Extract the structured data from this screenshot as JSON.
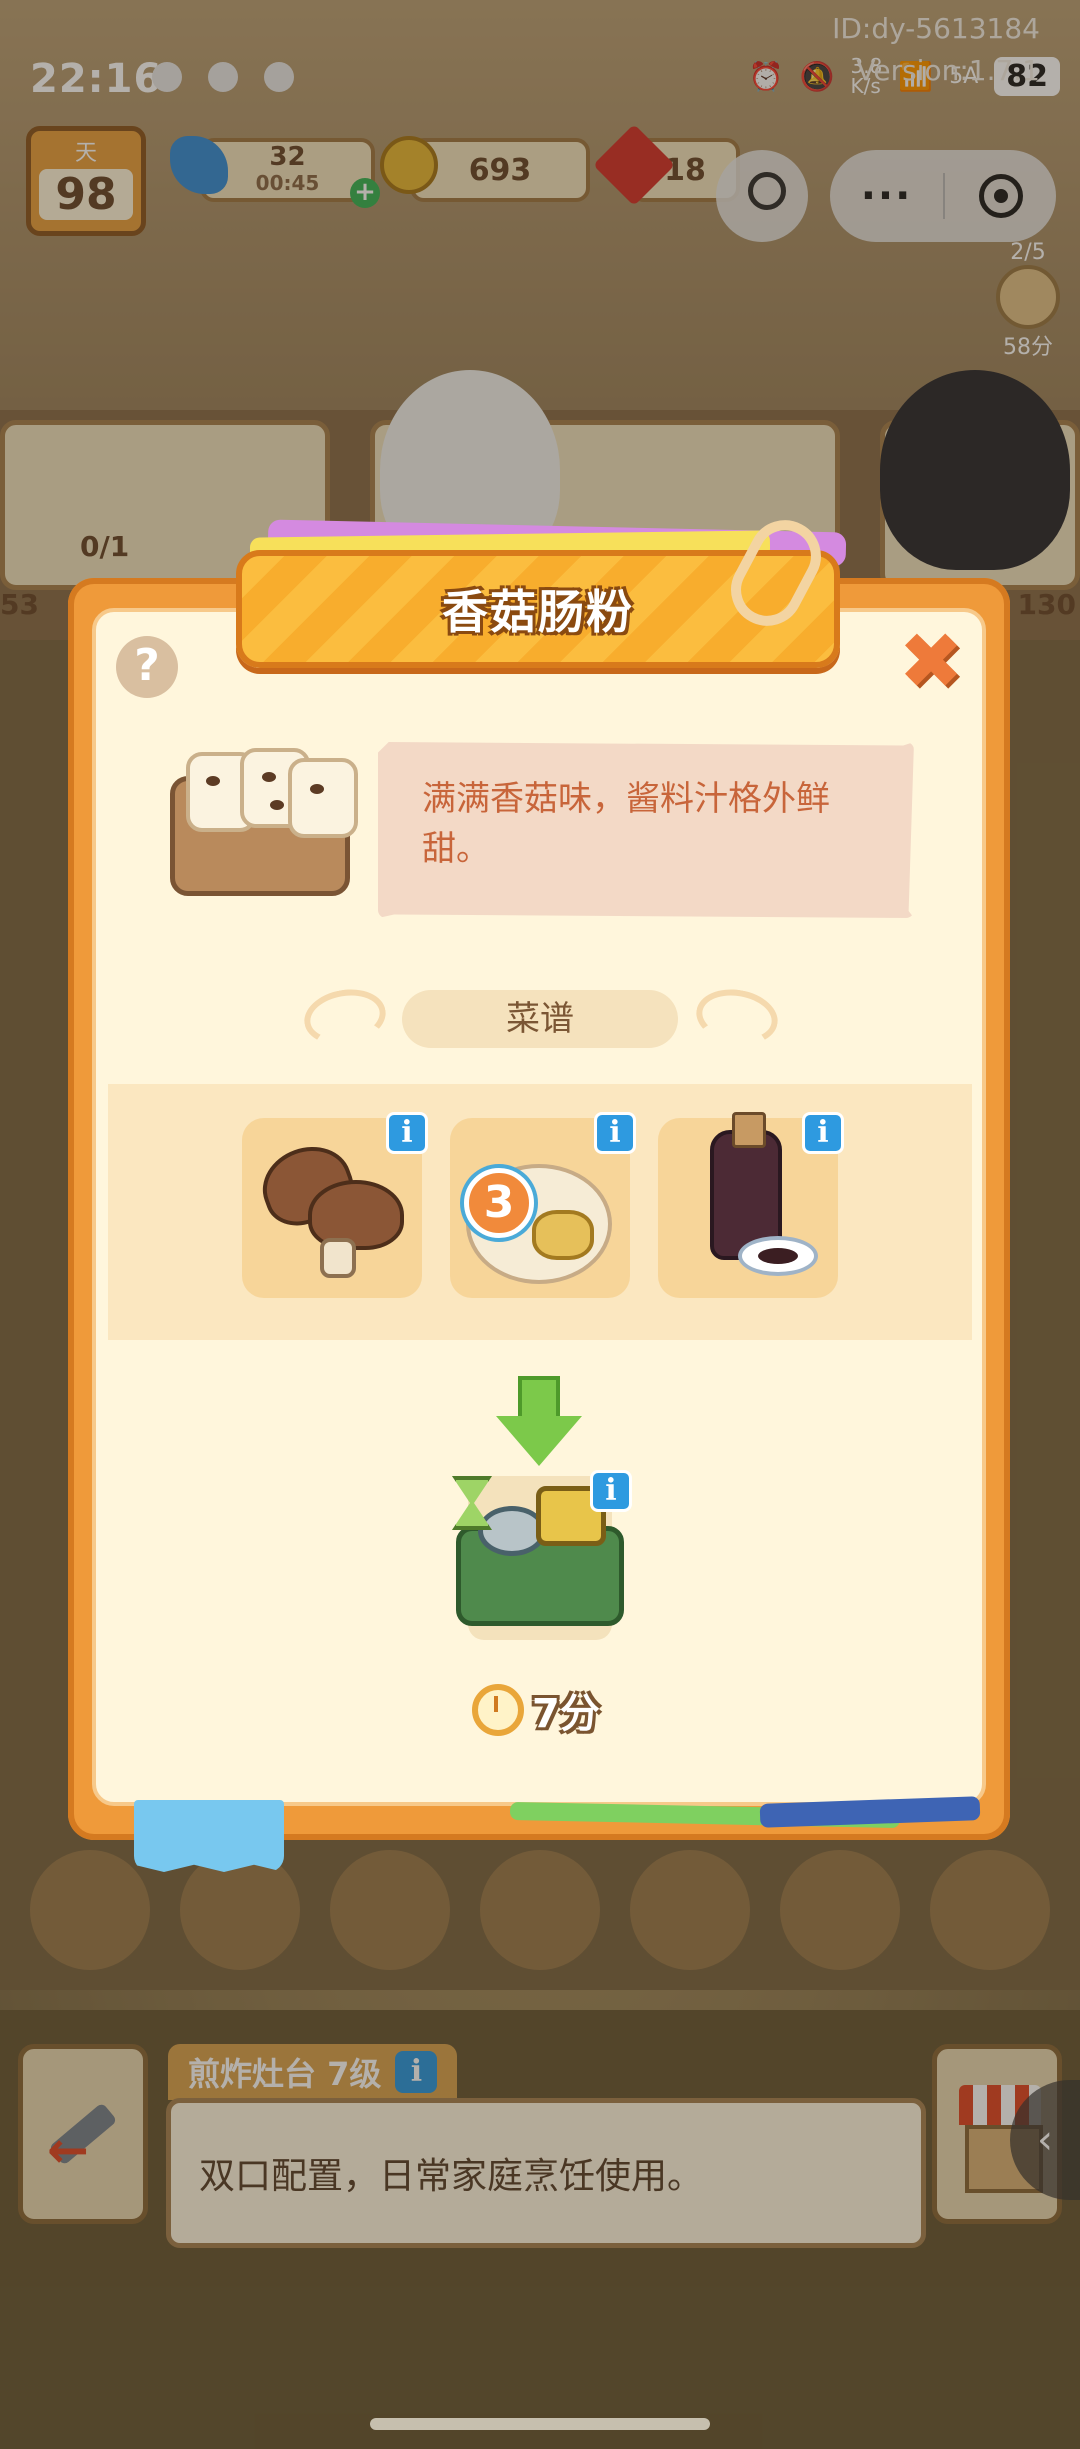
{
  "status_bar": {
    "time": "22:16",
    "network_speed": "3.8\nK/s",
    "network_type": "5A",
    "battery": "82",
    "debug_id": "ID:dy-5613184",
    "version": "Version:1.7.1"
  },
  "resources": {
    "day_label": "天",
    "day_value": "98",
    "energy": "32",
    "energy_timer": "00:45",
    "coins": "693",
    "gems": "18",
    "order_progress": "2/5",
    "order_time": "58分"
  },
  "background": {
    "order_count": "0/1",
    "left_number": "53",
    "right_number": "130"
  },
  "modal": {
    "title": "香菇肠粉",
    "description": "满满香菇味，酱料汁格外鲜甜。",
    "section_label": "菜谱",
    "ingredient_count": "3",
    "info_glyph": "i",
    "cook_time": "7分",
    "close_glyph": "✖",
    "help_glyph": "?"
  },
  "station": {
    "title": "煎炸灶台 7级",
    "description": "双口配置，日常家庭烹饪使用。"
  },
  "icons": {
    "side_arrow": "‹"
  },
  "colors": {
    "modal_frame": "#ef9a3a",
    "modal_body": "#fff6dc",
    "title_banner": "#fbbd3f",
    "description_card": "#f3d9c6",
    "info_badge": "#2e9ae0",
    "arrow_green": "#7cc94a"
  }
}
